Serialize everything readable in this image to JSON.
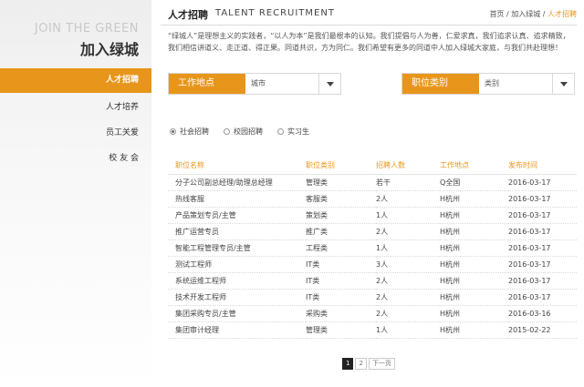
{
  "sidebar": {
    "brand_en": "JOIN THE GREEN",
    "brand_cn": "加入绿城",
    "items": [
      {
        "label": "人才招聘"
      },
      {
        "label": "人才培养"
      },
      {
        "label": "员工关爱"
      },
      {
        "label": "校 友 会"
      }
    ]
  },
  "header": {
    "title_cn": "人才招聘",
    "title_en": "TALENT RECRUITMENT",
    "breadcrumb": [
      "首页",
      "加入绿城",
      "人才招聘"
    ]
  },
  "intro": "“绿城人”是理想主义的实践者，“以人为本”是我们最根本的认知。我们提倡与人为善，仁爱求真，我们追求认真、追求精致，我们相信讲道义、走正道、得正果。同道共识，方为同仁。我们希望有更多的同道中人加入绿城大家庭，与我们共赴理想！",
  "filters": {
    "location": {
      "label": "工作地点",
      "value": "城市"
    },
    "category": {
      "label": "职位类别",
      "value": "类别"
    }
  },
  "radios": [
    {
      "label": "社会招聘",
      "checked": true
    },
    {
      "label": "校园招聘",
      "checked": false
    },
    {
      "label": "实习生",
      "checked": false
    }
  ],
  "table": {
    "headers": [
      "职位名称",
      "职位类别",
      "招聘人数",
      "工作地点",
      "发布时间"
    ],
    "rows": [
      [
        "分子公司副总经理/助理总经理",
        "管理类",
        "若干",
        "Q全国",
        "2016-03-17"
      ],
      [
        "热线客服",
        "客服类",
        "2人",
        "H杭州",
        "2016-03-17"
      ],
      [
        "产品策划专员/主管",
        "策划类",
        "1人",
        "H杭州",
        "2016-03-17"
      ],
      [
        "推广运营专员",
        "推广类",
        "2人",
        "H杭州",
        "2016-03-17"
      ],
      [
        "智能工程管理专员/主管",
        "工程类",
        "1人",
        "H杭州",
        "2016-03-17"
      ],
      [
        "测试工程师",
        "IT类",
        "3人",
        "H杭州",
        "2016-03-17"
      ],
      [
        "系统运维工程师",
        "IT类",
        "2人",
        "H杭州",
        "2016-03-17"
      ],
      [
        "技术开发工程师",
        "IT类",
        "2人",
        "H杭州",
        "2016-03-17"
      ],
      [
        "集团采购专员/主管",
        "采购类",
        "2人",
        "H杭州",
        "2016-03-16"
      ],
      [
        "集团审计经理",
        "管理类",
        "1人",
        "H杭州",
        "2015-02-22"
      ]
    ]
  },
  "pagination": {
    "pages": [
      "1",
      "2"
    ],
    "next": "下一页",
    "current": "1"
  },
  "colors": {
    "accent": "#e8961b"
  }
}
